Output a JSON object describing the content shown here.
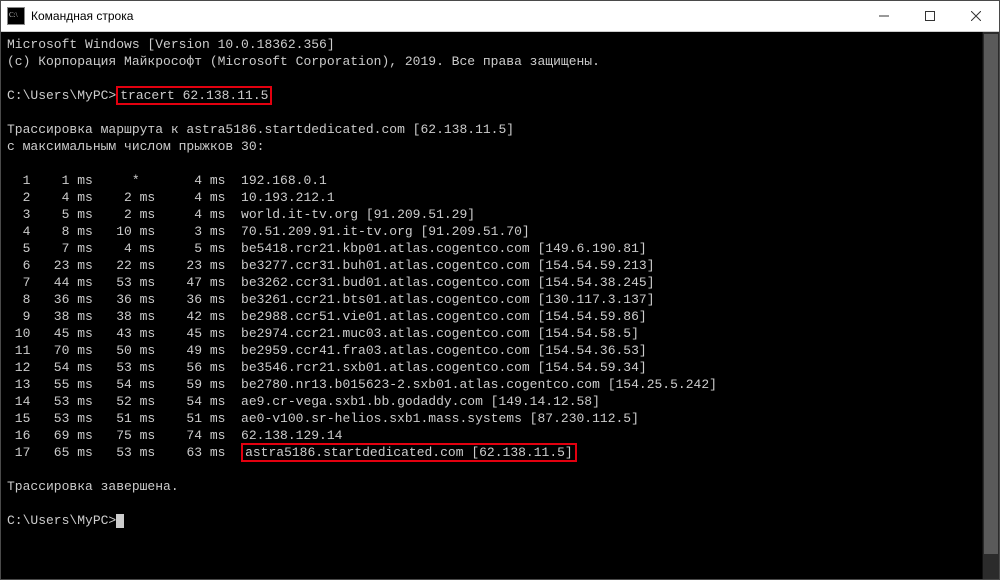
{
  "window": {
    "title": "Командная строка"
  },
  "header": {
    "line1": "Microsoft Windows [Version 10.0.18362.356]",
    "line2": "(c) Корпорация Майкрософт (Microsoft Corporation), 2019. Все права защищены."
  },
  "prompt1": {
    "path": "C:\\Users\\MyPC>",
    "cmd": "tracert 62.138.11.5"
  },
  "trace_header": {
    "line1": "Трассировка маршрута к astra5186.startdedicated.com [62.138.11.5]",
    "line2": "с максимальным числом прыжков 30:"
  },
  "hops": [
    {
      "n": "  1",
      "t1": "    1 ms",
      "t2": "     *   ",
      "t3": "    4 ms",
      "host": "192.168.0.1"
    },
    {
      "n": "  2",
      "t1": "    4 ms",
      "t2": "    2 ms ",
      "t3": "    4 ms",
      "host": "10.193.212.1"
    },
    {
      "n": "  3",
      "t1": "    5 ms",
      "t2": "    2 ms ",
      "t3": "    4 ms",
      "host": "world.it-tv.org [91.209.51.29]"
    },
    {
      "n": "  4",
      "t1": "    8 ms",
      "t2": "   10 ms ",
      "t3": "    3 ms",
      "host": "70.51.209.91.it-tv.org [91.209.51.70]"
    },
    {
      "n": "  5",
      "t1": "    7 ms",
      "t2": "    4 ms ",
      "t3": "    5 ms",
      "host": "be5418.rcr21.kbp01.atlas.cogentco.com [149.6.190.81]"
    },
    {
      "n": "  6",
      "t1": "   23 ms",
      "t2": "   22 ms ",
      "t3": "   23 ms",
      "host": "be3277.ccr31.buh01.atlas.cogentco.com [154.54.59.213]"
    },
    {
      "n": "  7",
      "t1": "   44 ms",
      "t2": "   53 ms ",
      "t3": "   47 ms",
      "host": "be3262.ccr31.bud01.atlas.cogentco.com [154.54.38.245]"
    },
    {
      "n": "  8",
      "t1": "   36 ms",
      "t2": "   36 ms ",
      "t3": "   36 ms",
      "host": "be3261.ccr21.bts01.atlas.cogentco.com [130.117.3.137]"
    },
    {
      "n": "  9",
      "t1": "   38 ms",
      "t2": "   38 ms ",
      "t3": "   42 ms",
      "host": "be2988.ccr51.vie01.atlas.cogentco.com [154.54.59.86]"
    },
    {
      "n": " 10",
      "t1": "   45 ms",
      "t2": "   43 ms ",
      "t3": "   45 ms",
      "host": "be2974.ccr21.muc03.atlas.cogentco.com [154.54.58.5]"
    },
    {
      "n": " 11",
      "t1": "   70 ms",
      "t2": "   50 ms ",
      "t3": "   49 ms",
      "host": "be2959.ccr41.fra03.atlas.cogentco.com [154.54.36.53]"
    },
    {
      "n": " 12",
      "t1": "   54 ms",
      "t2": "   53 ms ",
      "t3": "   56 ms",
      "host": "be3546.rcr21.sxb01.atlas.cogentco.com [154.54.59.34]"
    },
    {
      "n": " 13",
      "t1": "   55 ms",
      "t2": "   54 ms ",
      "t3": "   59 ms",
      "host": "be2780.nr13.b015623-2.sxb01.atlas.cogentco.com [154.25.5.242]"
    },
    {
      "n": " 14",
      "t1": "   53 ms",
      "t2": "   52 ms ",
      "t3": "   54 ms",
      "host": "ae9.cr-vega.sxb1.bb.godaddy.com [149.14.12.58]"
    },
    {
      "n": " 15",
      "t1": "   53 ms",
      "t2": "   51 ms ",
      "t3": "   51 ms",
      "host": "ae0-v100.sr-helios.sxb1.mass.systems [87.230.112.5]"
    },
    {
      "n": " 16",
      "t1": "   69 ms",
      "t2": "   75 ms ",
      "t3": "   74 ms",
      "host": "62.138.129.14"
    }
  ],
  "lasthop": {
    "n": " 17",
    "t1": "   65 ms",
    "t2": "   53 ms ",
    "t3": "   63 ms",
    "host": "astra5186.startdedicated.com [62.138.11.5]"
  },
  "footer": {
    "done": "Трассировка завершена."
  },
  "prompt2": {
    "path": "C:\\Users\\MyPC>"
  }
}
